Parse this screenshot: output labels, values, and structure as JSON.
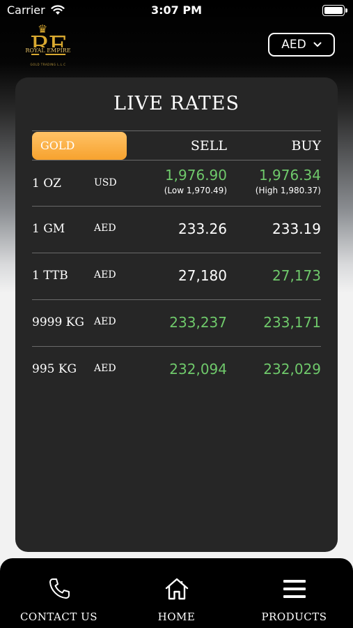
{
  "status_bar": {
    "carrier": "Carrier",
    "time": "3:07 PM"
  },
  "header": {
    "logo": {
      "monogram": "RE",
      "name": "ROYAL EMPIRE",
      "subtitle": "GOLD TRADING L.L.C"
    },
    "currency_select": {
      "value": "AED"
    }
  },
  "rates": {
    "title": "LIVE RATES",
    "tab": "GOLD",
    "col_sell": "SELL",
    "col_buy": "BUY",
    "rows": [
      {
        "qty": "1 OZ",
        "currency": "USD",
        "sell": "1,976.90",
        "buy": "1,976.34",
        "sell_sub": "(Low 1,970.49)",
        "buy_sub": "(High 1,980.37)",
        "sell_color": "green",
        "buy_color": "green"
      },
      {
        "qty": "1 GM",
        "currency": "AED",
        "sell": "233.26",
        "buy": "233.19",
        "sell_color": "white",
        "buy_color": "white"
      },
      {
        "qty": "1 TTB",
        "currency": "AED",
        "sell": "27,180",
        "buy": "27,173",
        "sell_color": "white",
        "buy_color": "green"
      },
      {
        "qty": "9999 KG",
        "currency": "AED",
        "sell": "233,237",
        "buy": "233,171",
        "sell_color": "green",
        "buy_color": "green"
      },
      {
        "qty": "995 KG",
        "currency": "AED",
        "sell": "232,094",
        "buy": "232,029",
        "sell_color": "green",
        "buy_color": "green"
      }
    ]
  },
  "nav": {
    "contact": {
      "label": "CONTACT US",
      "icon": "phone-icon"
    },
    "home": {
      "label": "HOME",
      "icon": "home-icon"
    },
    "products": {
      "label": "PRODUCTS",
      "icon": "menu-icon"
    }
  },
  "colors": {
    "gold_tab": "#f7a22e",
    "up_green": "#6fc96b",
    "card_bg": "#262626"
  }
}
